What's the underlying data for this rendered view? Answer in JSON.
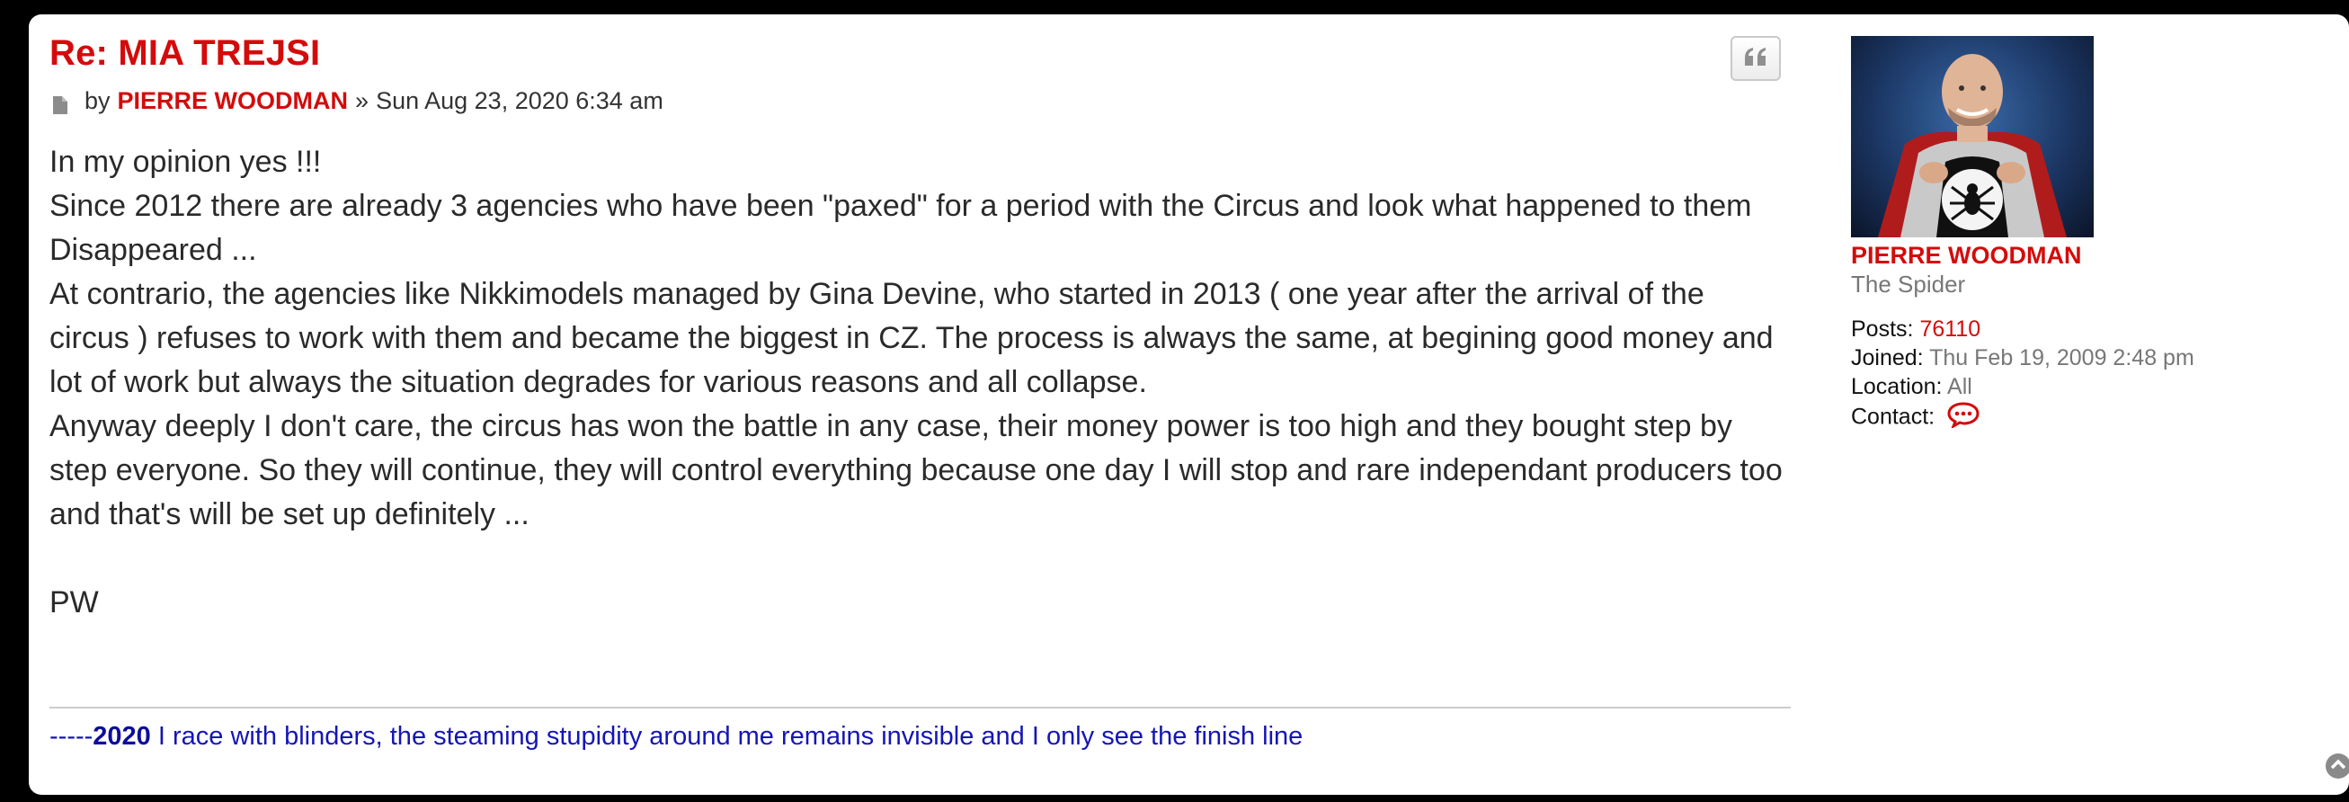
{
  "post": {
    "title": "Re: MIA TREJSI",
    "by_label": "by",
    "author": "PIERRE WOODMAN",
    "date_sep": "»",
    "date": "Sun Aug 23, 2020 6:34 am",
    "paragraphs": [
      "In my opinion yes !!!",
      "Since 2012 there are already 3 agencies who have been \"paxed\" for a period with the Circus and look what happened to them",
      "Disappeared ...",
      "At contrario, the agencies like Nikkimodels managed by Gina Devine, who started in 2013 ( one year after the arrival of the circus ) refuses to work with them and became the biggest in CZ. The process is always the same, at begining good money and lot of work but always the situation degrades for various reasons and all collapse.",
      "Anyway deeply I don't care, the circus has won the battle in any case, their money power is too high and they bought step by step everyone. So they will continue, they will control everything because one day I will stop and rare independant producers too and that's will be set up definitely ...",
      "PW"
    ],
    "signature": {
      "prefix": "-----",
      "year": "2020",
      "text": " I race with blinders, the steaming stupidity around me remains invisible and I only see the finish line"
    }
  },
  "profile": {
    "name": "PIERRE WOODMAN",
    "rank": "The Spider",
    "posts_label": "Posts:",
    "posts_value": "76110",
    "joined_label": "Joined:",
    "joined_value": "Thu Feb 19, 2009 2:48 pm",
    "location_label": "Location:",
    "location_value": "All",
    "contact_label": "Contact:"
  },
  "colors": {
    "accent": "#d40b0b",
    "signature": "#1515b5"
  },
  "icons": {
    "quote": "quote-icon",
    "post": "document-icon",
    "contact": "speech-bubble-icon",
    "top": "chevron-up-icon"
  }
}
